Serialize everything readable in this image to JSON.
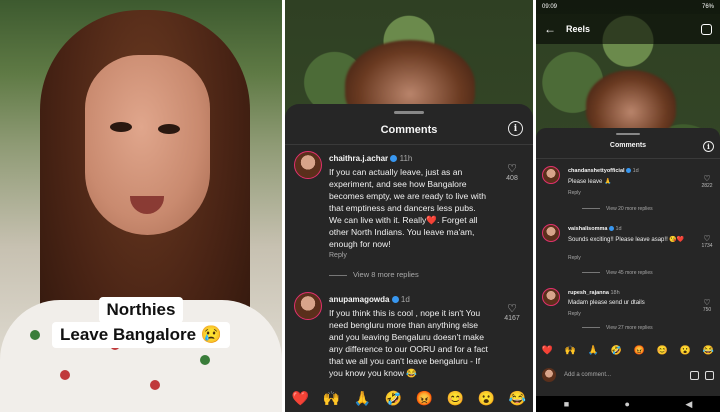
{
  "panel1": {
    "caption_line1": "Northies",
    "caption_line2": "Leave Bangalore 😢"
  },
  "panel2": {
    "sheet_title": "Comments",
    "info_icon": "i",
    "comments": [
      {
        "username": "chaithra.j.achar",
        "time": "11h",
        "text": "If you can actually leave, just as an experiment, and see how Bangalore becomes empty, we are ready to live with that emptiness and dancers less pubs. We can live with it. Really❤️. Forget all other North Indians. You leave ma'am, enough for now!",
        "reply": "Reply",
        "likes": "408",
        "view_more": "View 8 more replies"
      },
      {
        "username": "anupamagowda",
        "time": "1d",
        "text": "If you think this is cool , nope it isn't You need bengluru more than anything else and you leaving Bengaluru doesn't make any difference to our OORU and for a fact that we all you can't leave bengaluru - If you know you know 😂",
        "likes": "4167"
      }
    ],
    "emojis": [
      "❤️",
      "🙌",
      "🙏",
      "🤣",
      "😡",
      "😊",
      "😮",
      "😂"
    ]
  },
  "panel3": {
    "status_time": "09:09",
    "status_battery": "76%",
    "reels_title": "Reels",
    "sheet_title": "Comments",
    "info_icon": "i",
    "comments": [
      {
        "username": "chandanshettyofficial",
        "time": "1d",
        "text": "Please leave 🙏",
        "reply": "Reply",
        "likes": "2822",
        "view_more": "View 20 more replies"
      },
      {
        "username": "vaishalisomma",
        "time": "1d",
        "text": "Sounds exciting!! Please leave asap!! 😘❤️",
        "reply": "Reply",
        "likes": "1734",
        "view_more": "View 45 more replies"
      },
      {
        "username": "rupesh_rajanna",
        "time": "18h",
        "text": "Madam please send ur dtails",
        "reply": "Reply",
        "likes": "750",
        "view_more": "View 27 more replies"
      }
    ],
    "emojis": [
      "❤️",
      "🙌",
      "🙏",
      "🤣",
      "😡",
      "😊",
      "😮",
      "😂"
    ],
    "add_comment_placeholder": "Add a comment...",
    "nav": [
      "■",
      "●",
      "◀"
    ]
  }
}
